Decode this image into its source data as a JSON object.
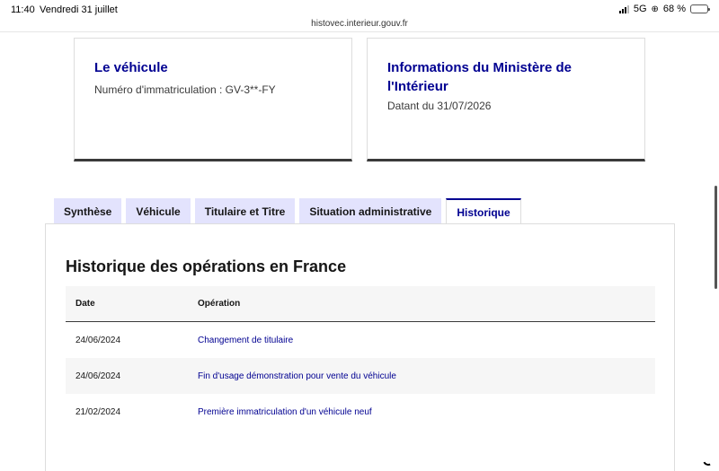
{
  "status_bar": {
    "time": "11:40",
    "date": "Vendredi 31 juillet",
    "url": "histovec.interieur.gouv.fr",
    "network": "5G",
    "battery": "68 %",
    "battery_level": 0.68
  },
  "cards": {
    "vehicle": {
      "title": "Le véhicule",
      "text": "Numéro d'immatriculation : GV-3**-FY"
    },
    "ministry": {
      "title": "Informations du Ministère de l'Intérieur",
      "text": "Datant du 31/07/2026"
    }
  },
  "tabs": [
    {
      "label": "Synthèse",
      "active": false
    },
    {
      "label": "Véhicule",
      "active": false
    },
    {
      "label": "Titulaire et Titre",
      "active": false
    },
    {
      "label": "Situation administrative",
      "active": false
    },
    {
      "label": "Historique",
      "active": true
    }
  ],
  "history": {
    "title": "Historique des opérations en France",
    "headers": {
      "date": "Date",
      "operation": "Opération"
    },
    "rows": [
      {
        "date": "24/06/2024",
        "operation": "Changement de titulaire"
      },
      {
        "date": "24/06/2024",
        "operation": "Fin d'usage démonstration pour vente du véhicule"
      },
      {
        "date": "21/02/2024",
        "operation": "Première immatriculation d'un véhicule neuf"
      }
    ]
  },
  "colors": {
    "brand_blue": "#000091",
    "tab_background": "#e3e3fd",
    "table_stripe": "#f6f6f6"
  }
}
